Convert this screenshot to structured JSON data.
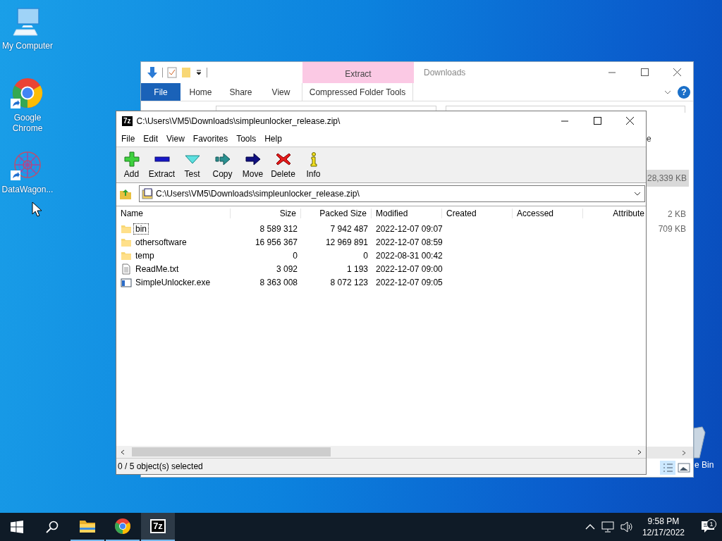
{
  "desktop": {
    "icons": [
      {
        "label": "My Computer",
        "kind": "computer",
        "shortcut": false
      },
      {
        "label": "Google Chrome",
        "kind": "chrome",
        "shortcut": true
      },
      {
        "label": "DataWagon...",
        "kind": "app",
        "shortcut": true
      }
    ],
    "partial_label": "e Bin"
  },
  "explorer": {
    "contextual_header": "Extract",
    "title": "Downloads",
    "tabs": [
      {
        "label": "File",
        "kind": "file"
      },
      {
        "label": "Home",
        "kind": "tab"
      },
      {
        "label": "Share",
        "kind": "tab"
      },
      {
        "label": "View",
        "kind": "tab"
      },
      {
        "label": "Compressed Folder Tools",
        "kind": "contextual"
      }
    ],
    "help": "?",
    "column_fragment": "e",
    "sizes": [
      {
        "text": "28,339 KB",
        "selected": true
      },
      {
        "text": "2 KB",
        "selected": false
      },
      {
        "text": "709 KB",
        "selected": false
      }
    ]
  },
  "archive_window": {
    "logo": "7z",
    "title": "C:\\Users\\VM5\\Downloads\\simpleunlocker_release.zip\\",
    "menu": [
      "File",
      "Edit",
      "View",
      "Favorites",
      "Tools",
      "Help"
    ],
    "toolbar": [
      {
        "label": "Add",
        "kind": "add"
      },
      {
        "label": "Extract",
        "kind": "extract"
      },
      {
        "label": "Test",
        "kind": "test"
      },
      {
        "label": "Copy",
        "kind": "copy"
      },
      {
        "label": "Move",
        "kind": "move"
      },
      {
        "label": "Delete",
        "kind": "delete"
      },
      {
        "label": "Info",
        "kind": "info"
      }
    ],
    "path": "C:\\Users\\VM5\\Downloads\\simpleunlocker_release.zip\\",
    "columns": [
      "Name",
      "Size",
      "Packed Size",
      "Modified",
      "Created",
      "Accessed",
      "Attribute"
    ],
    "rows": [
      {
        "name": "bin",
        "kind": "folder",
        "size": "8 589 312",
        "packed_size": "7 942 487",
        "modified": "2022-12-07 09:07",
        "focused": true
      },
      {
        "name": "othersoftware",
        "kind": "folder",
        "size": "16 956 367",
        "packed_size": "12 969 891",
        "modified": "2022-12-07 08:59",
        "focused": false
      },
      {
        "name": "temp",
        "kind": "folder",
        "size": "0",
        "packed_size": "0",
        "modified": "2022-08-31 00:42",
        "focused": false
      },
      {
        "name": "ReadMe.txt",
        "kind": "text",
        "size": "3 092",
        "packed_size": "1 193",
        "modified": "2022-12-07 09:00",
        "focused": false
      },
      {
        "name": "SimpleUnlocker.exe",
        "kind": "exe",
        "size": "8 363 008",
        "packed_size": "8 072 123",
        "modified": "2022-12-07 09:05",
        "focused": false
      }
    ],
    "status": "0 / 5 object(s) selected"
  },
  "taskbar": {
    "items": [
      {
        "kind": "start"
      },
      {
        "kind": "search"
      },
      {
        "kind": "explorer",
        "running": true,
        "active": false
      },
      {
        "kind": "chrome",
        "running": true,
        "active": false
      },
      {
        "kind": "archiver",
        "label": "7z",
        "running": true,
        "active": true
      }
    ],
    "clock": {
      "time": "9:58 PM",
      "date": "12/17/2022"
    },
    "notification_count": "1"
  }
}
